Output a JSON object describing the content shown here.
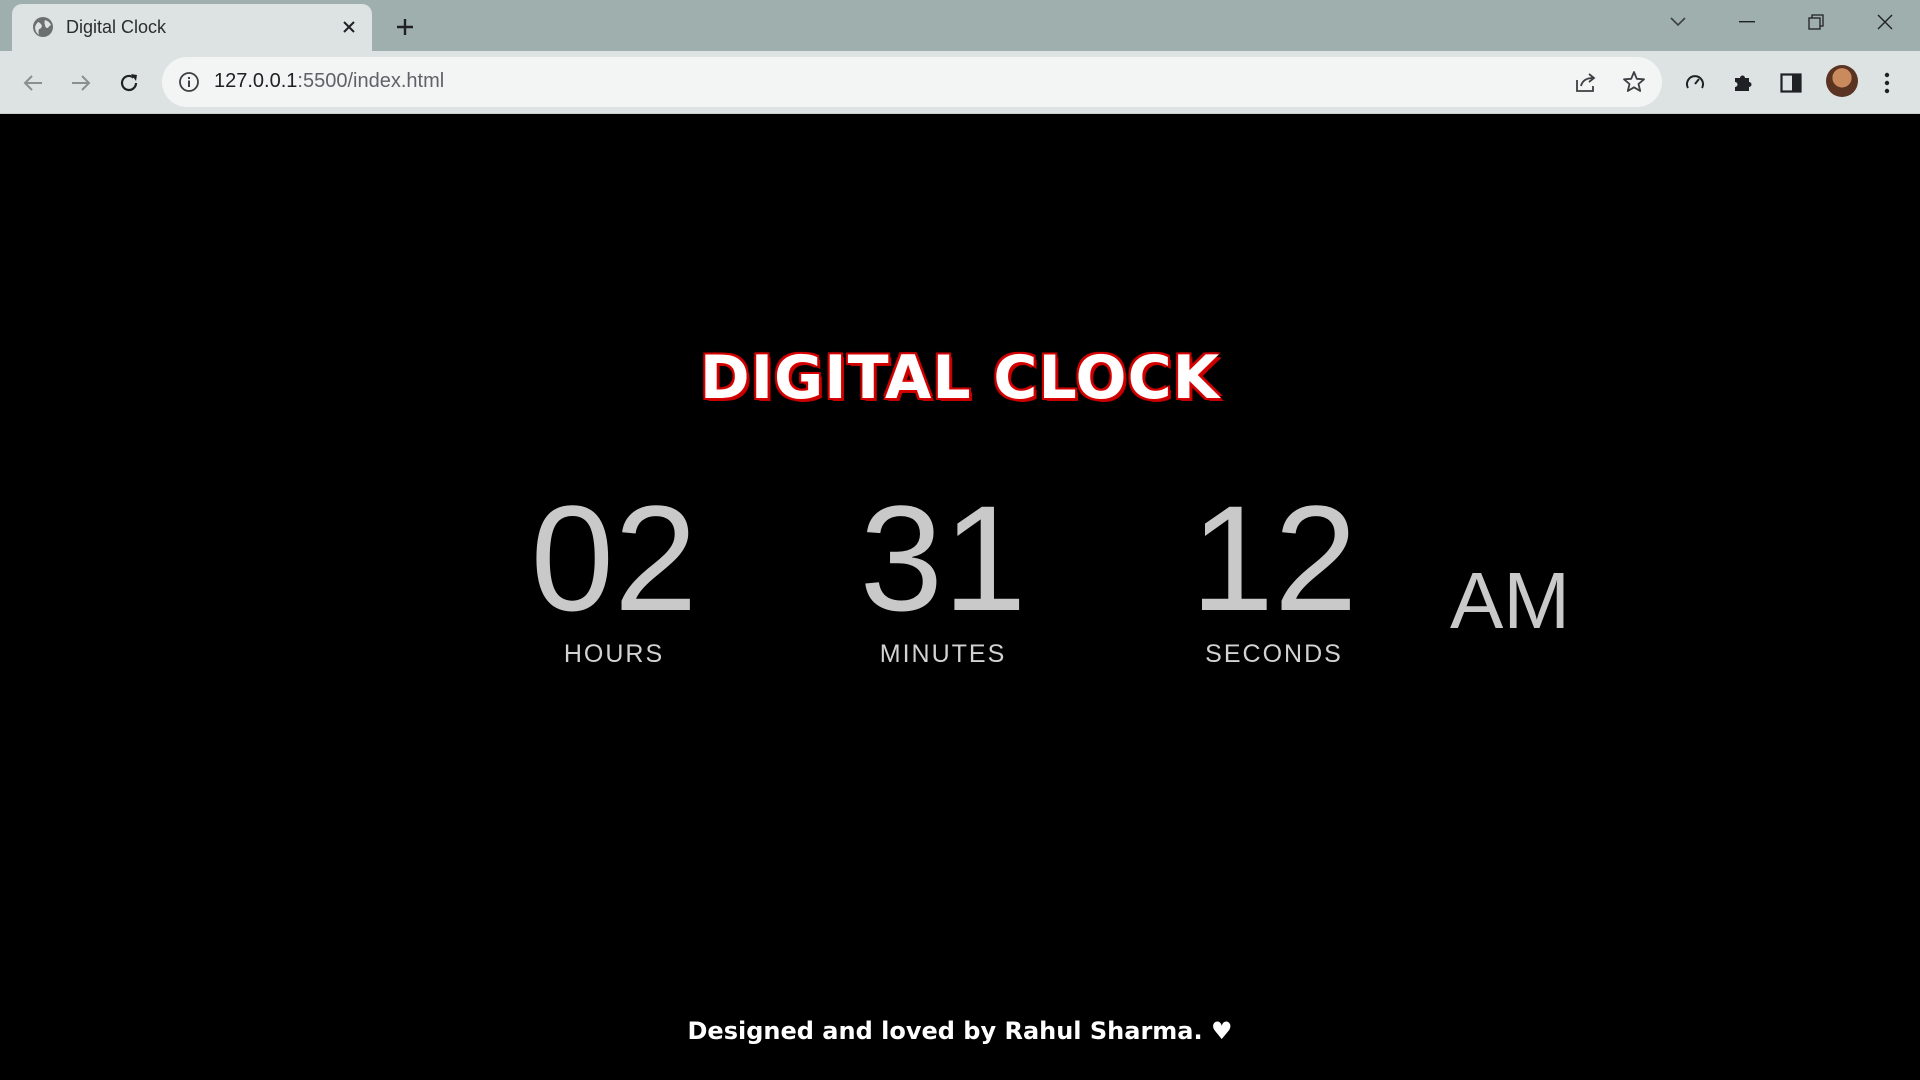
{
  "browser": {
    "tab_title": "Digital Clock",
    "url_host": "127.0.0.1",
    "url_rest": ":5500/index.html"
  },
  "icons": {
    "tab_favicon": "globe-icon",
    "tab_close": "close-icon",
    "new_tab": "plus-icon",
    "tab_search": "chevron-down-icon",
    "minimize": "minimize-icon",
    "restore": "restore-icon",
    "close_window": "close-icon",
    "back": "arrow-left-icon",
    "forward": "arrow-right-icon",
    "reload": "reload-icon",
    "site_info": "info-icon",
    "share": "share-icon",
    "bookmark": "star-icon",
    "performance": "speedometer-icon",
    "extensions": "puzzle-icon",
    "side_panel": "side-panel-icon",
    "menu": "kebab-menu-icon"
  },
  "clock": {
    "title": "DIGITAL CLOCK",
    "hours": "02",
    "hours_label": "HOURS",
    "minutes": "31",
    "minutes_label": "MINUTES",
    "seconds": "12",
    "seconds_label": "SECONDS",
    "period": "AM"
  },
  "footer": {
    "text": "Designed and loved by Rahul Sharma. ♥"
  },
  "colors": {
    "page_background": "#000000",
    "title_glow": "#c40000",
    "digits": "#c9c9c9"
  }
}
